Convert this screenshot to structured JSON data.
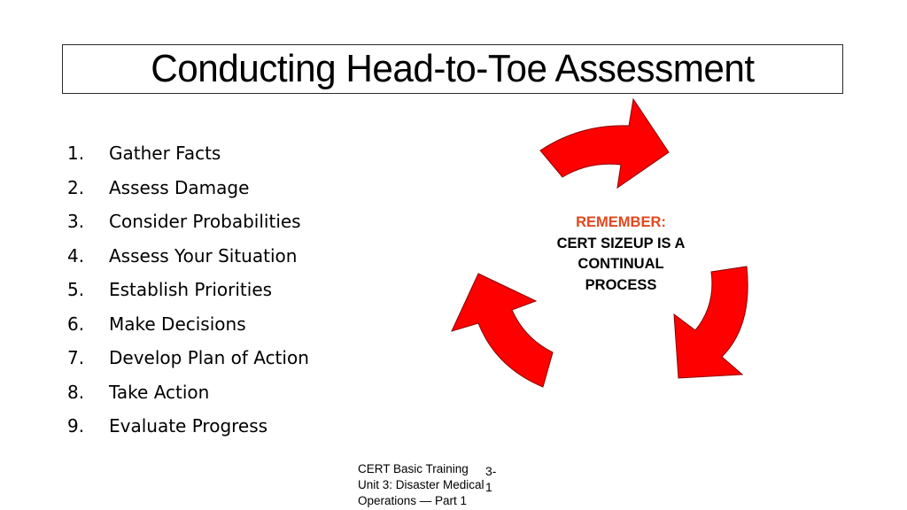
{
  "slide": {
    "title": "Conducting Head-to-Toe Assessment",
    "steps": [
      {
        "number": "1.",
        "label": "Gather Facts"
      },
      {
        "number": "2.",
        "label": "Assess Damage"
      },
      {
        "number": "3.",
        "label": "Consider Probabilities"
      },
      {
        "number": "4.",
        "label": "Assess Your Situation"
      },
      {
        "number": "5.",
        "label": "Establish Priorities"
      },
      {
        "number": "6.",
        "label": "Make Decisions"
      },
      {
        "number": "7.",
        "label": "Develop Plan of Action"
      },
      {
        "number": "8.",
        "label": "Take Action"
      },
      {
        "number": "9.",
        "label": "Evaluate Progress"
      }
    ],
    "cycle_diagram": {
      "arrow_icon": "curved-arrow-icon",
      "arrow_color": "#ff0000",
      "arrow_outline": "#8b0000",
      "remember_label": "REMEMBER:",
      "remember_color": "#e2481f",
      "message_lines": [
        "CERT SIZEUP IS A",
        "CONTINUAL",
        "PROCESS"
      ]
    },
    "footer": {
      "lines": [
        "CERT Basic Training",
        "Unit 3: Disaster Medical",
        "Operations — Part 1"
      ],
      "page_number": "3-1"
    }
  }
}
